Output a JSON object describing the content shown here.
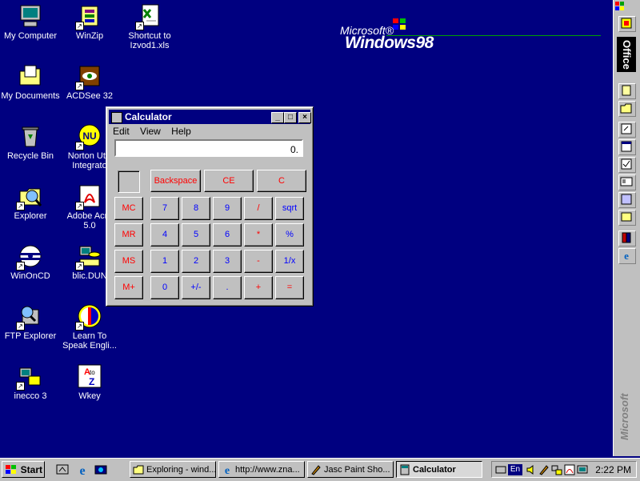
{
  "desktop": {
    "icons": [
      {
        "label": "My Computer",
        "icon": "computer-icon"
      },
      {
        "label": "WinZip",
        "icon": "winzip-icon"
      },
      {
        "label": "Shortcut to\nIzvod1.xls",
        "icon": "excel-file-icon"
      },
      {
        "label": "My Documents",
        "icon": "folder-icon"
      },
      {
        "label": "ACDSee 32",
        "icon": "acdsee-icon"
      },
      {
        "label": "Recycle Bin",
        "icon": "recycle-bin-icon"
      },
      {
        "label": "Norton Utili\nIntegrato",
        "icon": "norton-icon"
      },
      {
        "label": "Explorer",
        "icon": "explorer-icon"
      },
      {
        "label": "Adobe Acro\n5.0",
        "icon": "acrobat-icon"
      },
      {
        "label": "WinOnCD",
        "icon": "cd-icon"
      },
      {
        "label": "blic.DUN",
        "icon": "dialup-icon"
      },
      {
        "label": "FTP Explorer",
        "icon": "ftp-icon"
      },
      {
        "label": "Learn To\nSpeak Engli...",
        "icon": "globe-icon"
      },
      {
        "label": "inecco 3",
        "icon": "network-icon"
      },
      {
        "label": "Wkey",
        "icon": "keyboard-icon"
      }
    ],
    "logo": {
      "microsoft": "Microsoft®",
      "windows": "Windows98"
    }
  },
  "office_bar": {
    "title": "Office",
    "brand": "Microsoft"
  },
  "calculator": {
    "title": "Calculator",
    "menu": [
      "Edit",
      "View",
      "Help"
    ],
    "display": "0.",
    "top_buttons": [
      "Backspace",
      "CE",
      "C"
    ],
    "memory_buttons": [
      "MC",
      "MR",
      "MS",
      "M+"
    ],
    "rows": [
      [
        "7",
        "8",
        "9",
        "/",
        "sqrt"
      ],
      [
        "4",
        "5",
        "6",
        "*",
        "%"
      ],
      [
        "1",
        "2",
        "3",
        "-",
        "1/x"
      ],
      [
        "0",
        "+/-",
        ".",
        "+",
        "="
      ]
    ],
    "title_buttons": {
      "minimize": "_",
      "maximize": "□",
      "close": "×"
    }
  },
  "taskbar": {
    "start": "Start",
    "tasks": [
      {
        "label": "Exploring - wind...",
        "icon": "folder-icon"
      },
      {
        "label": "http://www.zna...",
        "icon": "ie-icon"
      },
      {
        "label": "Jasc Paint Sho...",
        "icon": "paintshop-icon"
      },
      {
        "label": "Calculator",
        "icon": "calculator-icon",
        "active": true
      }
    ],
    "tray": {
      "lang": "En",
      "clock": "2:22 PM"
    }
  },
  "colors": {
    "desktop": "#000080",
    "titlebar": "#000080",
    "button_face": "#c0c0c0"
  }
}
